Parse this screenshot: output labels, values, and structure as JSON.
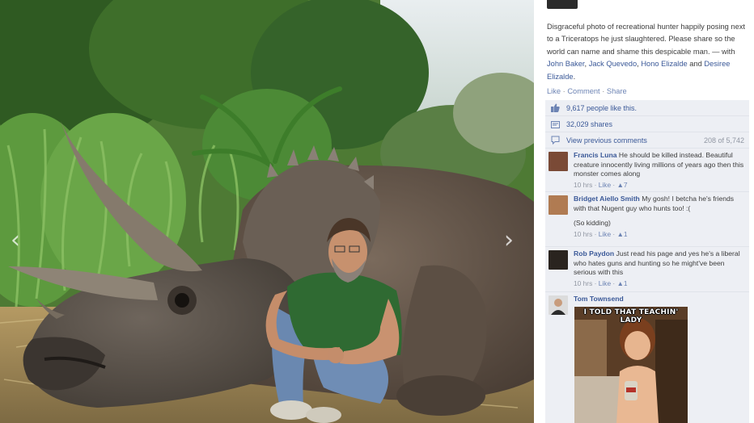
{
  "viewer": {
    "prev_arrow": "‹",
    "next_arrow": "›"
  },
  "post": {
    "caption": "Disgraceful photo of recreational hunter happily posing next to a Triceratops he just slaughtered. Please share so the world can name and shame this despicable man.",
    "with_prefix": " — with ",
    "tag_1": "John Baker",
    "sep_1": ", ",
    "tag_2": "Jack Quevedo",
    "sep_2": ", ",
    "tag_3": "Hono Elizalde",
    "sep_3": " and ",
    "tag_4": "Desiree Elizalde",
    "end": ".",
    "actions": {
      "like": "Like",
      "comment": "Comment",
      "share": "Share",
      "dot": " · "
    }
  },
  "ufi": {
    "likes": "9,617 people like this.",
    "shares": "32,029 shares",
    "view_previous": "View previous comments",
    "comment_count": "208 of 5,742"
  },
  "comments": [
    {
      "name": "Francis Luna",
      "text": " He should be killed instead. Beautiful creature innocently living millions of years ago then this monster comes along",
      "time": "10 hrs",
      "like": "Like",
      "likes": "7"
    },
    {
      "name": "Bridget Aiello Smith",
      "text": " My gosh! I betcha he's friends with that Nugent guy who hunts too! :(",
      "extra": "(So kidding)",
      "time": "10 hrs",
      "like": "Like",
      "likes": "1"
    },
    {
      "name": "Rob Paydon",
      "text": " Just read his page and yes he's a liberal who hates guns and hunting so he might've been serious with this",
      "time": "10 hrs",
      "like": "Like",
      "likes": "1"
    },
    {
      "name": "Tom Townsend"
    }
  ],
  "meme": {
    "top_text": "I TOLD THAT TEACHIN' LADY"
  },
  "colors": {
    "link": "#3b5998",
    "ufi_bg": "#edeff4"
  }
}
